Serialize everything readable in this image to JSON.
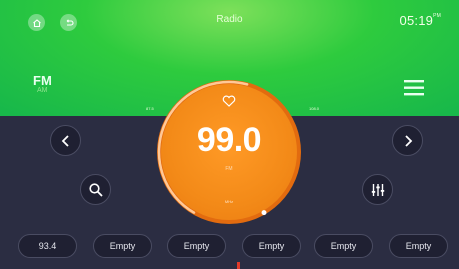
{
  "header": {
    "title": "Radio",
    "clock": "05:19",
    "clock_suffix": "PM",
    "home_icon": "home-icon",
    "back_icon": "back-icon"
  },
  "band": {
    "primary": "FM",
    "secondary": "AM"
  },
  "scale": {
    "left_label": "87.5",
    "right_label": "108.0"
  },
  "tuner": {
    "frequency": "99.0",
    "band": "FM",
    "unit": "MHz",
    "position_fraction": 0.55
  },
  "controls": {
    "prev_icon": "chevron-left-icon",
    "next_icon": "chevron-right-icon",
    "search_icon": "search-icon",
    "eq_icon": "equalizer-icon",
    "menu_icon": "menu-icon",
    "favorite_icon": "heart-icon"
  },
  "presets": [
    {
      "label": "93.4"
    },
    {
      "label": "Empty"
    },
    {
      "label": "Empty"
    },
    {
      "label": "Empty"
    },
    {
      "label": "Empty"
    },
    {
      "label": "Empty"
    }
  ],
  "colors": {
    "header_green": "#2ecb3e",
    "dial_orange": "#f38a18",
    "background_navy": "#2b2d42"
  }
}
